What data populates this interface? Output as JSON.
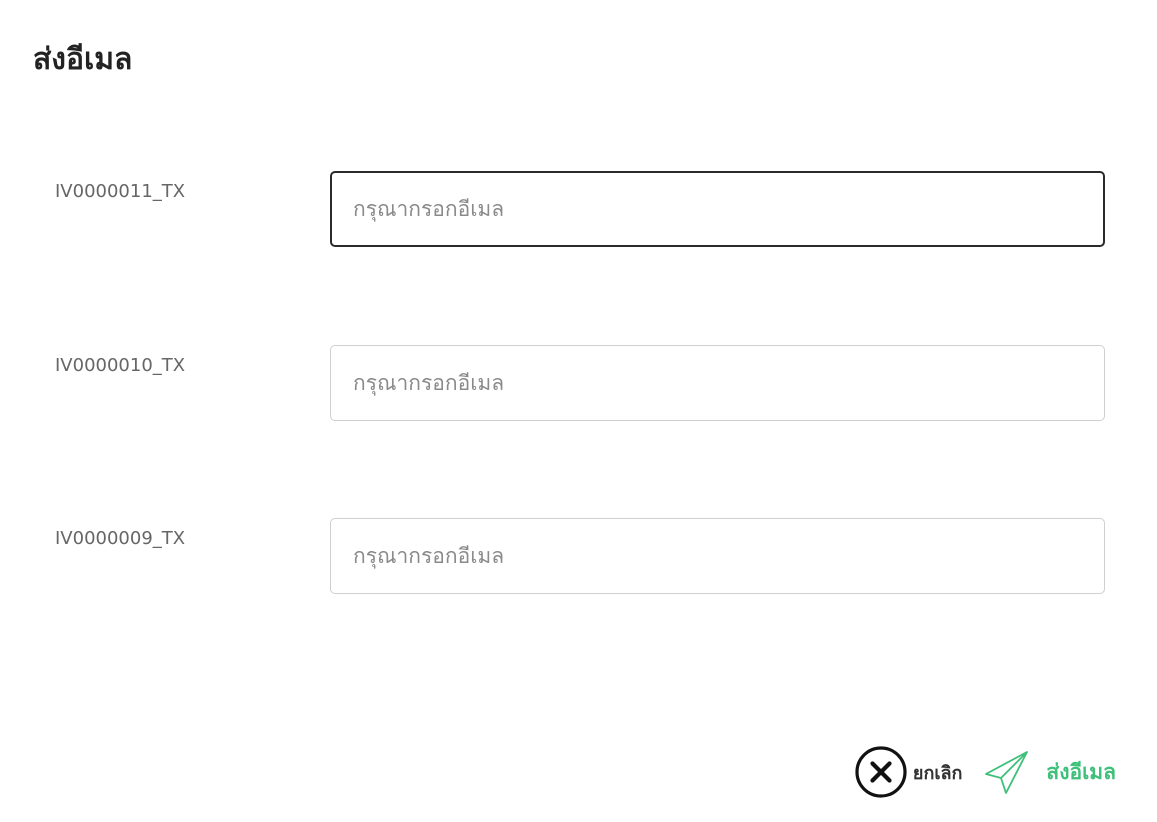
{
  "dialog": {
    "title": "ส่งอีเมล"
  },
  "rows": [
    {
      "label": "IV0000011_TX",
      "value": "",
      "placeholder": "กรุณากรอกอีเมล",
      "focused": true
    },
    {
      "label": "IV0000010_TX",
      "value": "",
      "placeholder": "กรุณากรอกอีเมล",
      "focused": false
    },
    {
      "label": "IV0000009_TX",
      "value": "",
      "placeholder": "กรุณากรอกอีเมล",
      "focused": false
    }
  ],
  "footer": {
    "cancel_label": "ยกเลิก",
    "cancel_icon": "close-circle-icon",
    "send_label": "ส่งอีเมล",
    "send_icon": "paper-plane-icon"
  },
  "colors": {
    "accent": "#3ec07a",
    "text": "#222222",
    "label": "#666666",
    "input_border": "#cfcfcf",
    "input_focus_border": "#2b2b2b"
  }
}
